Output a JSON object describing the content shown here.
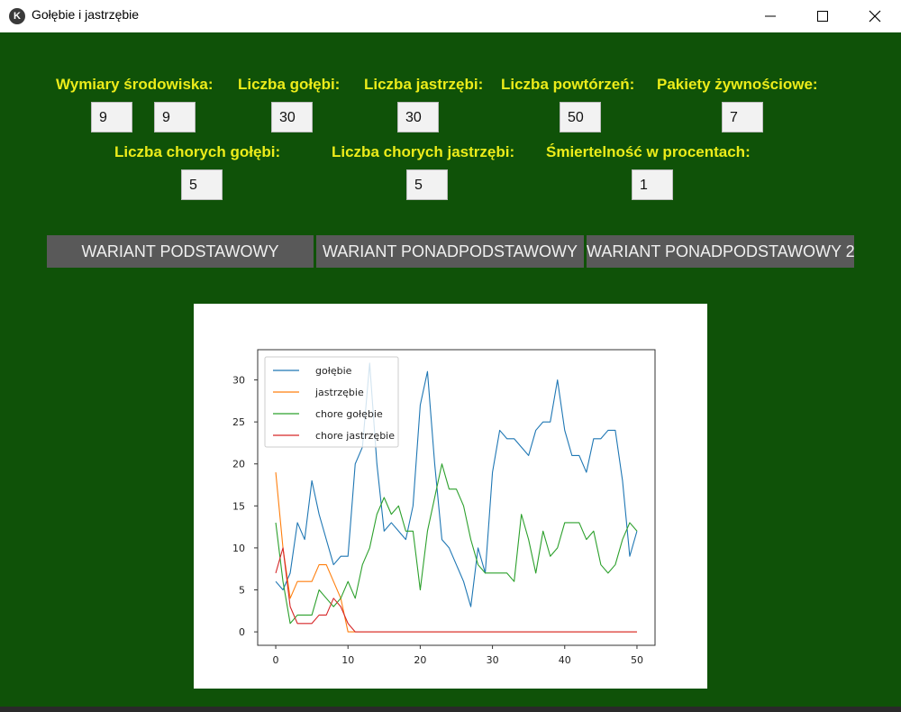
{
  "window": {
    "title": "Gołębie i jastrzębie",
    "app_icon": "kivy-icon"
  },
  "form": {
    "dimensions_label": "Wymiary środowiska:",
    "dimension_x": "9",
    "dimension_y": "9",
    "doves_label": "Liczba gołębi:",
    "doves_value": "30",
    "hawks_label": "Liczba jastrzębi:",
    "hawks_value": "30",
    "repetitions_label": "Liczba powtórzeń:",
    "repetitions_value": "50",
    "food_label": "Pakiety żywnościowe:",
    "food_value": "7",
    "sick_doves_label": "Liczba chorych gołębi:",
    "sick_doves_value": "5",
    "sick_hawks_label": "Liczba chorych jastrzębi:",
    "sick_hawks_value": "5",
    "mortality_label": "Śmiertelność w procentach:",
    "mortality_value": "1"
  },
  "buttons": {
    "basic": "WARIANT PODSTAWOWY",
    "advanced": "WARIANT PONADPODSTAWOWY",
    "advanced2": "WARIANT PONADPODSTAWOWY 2"
  },
  "colors": {
    "background": "#0f5208",
    "label": "#ecec1a",
    "button": "#595959",
    "golebie": "#1f77b4",
    "jastrzebie": "#ff7f0e",
    "chore_golebie": "#2ca02c",
    "chore_jastrzebie": "#d62728"
  },
  "chart_data": {
    "type": "line",
    "title": "",
    "xlabel": "",
    "ylabel": "",
    "xlim": [
      -2.5,
      52.5
    ],
    "ylim": [
      -1.6,
      33.6
    ],
    "xticks": [
      0,
      10,
      20,
      30,
      40,
      50
    ],
    "yticks": [
      0,
      5,
      10,
      15,
      20,
      25,
      30
    ],
    "grid": false,
    "legend_position": "upper-left",
    "x": [
      0,
      1,
      2,
      3,
      4,
      5,
      6,
      7,
      8,
      9,
      10,
      11,
      12,
      13,
      14,
      15,
      16,
      17,
      18,
      19,
      20,
      21,
      22,
      23,
      24,
      25,
      26,
      27,
      28,
      29,
      30,
      31,
      32,
      33,
      34,
      35,
      36,
      37,
      38,
      39,
      40,
      41,
      42,
      43,
      44,
      45,
      46,
      47,
      48,
      49,
      50
    ],
    "series": [
      {
        "name": "gołębie",
        "color": "#1f77b4",
        "values": [
          6,
          5,
          7,
          13,
          11,
          18,
          14,
          11,
          8,
          9,
          9,
          20,
          22,
          32,
          20,
          12,
          13,
          12,
          11,
          15,
          27,
          31,
          20,
          11,
          10,
          8,
          6,
          3,
          10,
          7,
          19,
          24,
          23,
          23,
          22,
          21,
          24,
          25,
          25,
          30,
          24,
          21,
          21,
          19,
          23,
          23,
          24,
          24,
          18,
          9,
          12
        ]
      },
      {
        "name": "jastrzębie",
        "color": "#ff7f0e",
        "values": [
          19,
          10,
          4,
          6,
          6,
          6,
          8,
          8,
          6,
          4,
          0,
          0,
          0,
          0,
          0,
          0,
          0,
          0,
          0,
          0,
          0,
          0,
          0,
          0,
          0,
          0,
          0,
          0,
          0,
          0,
          0,
          0,
          0,
          0,
          0,
          0,
          0,
          0,
          0,
          0,
          0,
          0,
          0,
          0,
          0,
          0,
          0,
          0,
          0,
          0,
          0
        ]
      },
      {
        "name": "chore gołębie",
        "color": "#2ca02c",
        "values": [
          13,
          6,
          1,
          2,
          2,
          2,
          5,
          4,
          3,
          4,
          6,
          4,
          8,
          10,
          14,
          16,
          14,
          15,
          12,
          12,
          5,
          12,
          16,
          20,
          17,
          17,
          15,
          11,
          8,
          7,
          7,
          7,
          7,
          6,
          14,
          11,
          7,
          12,
          9,
          10,
          13,
          13,
          13,
          11,
          12,
          8,
          7,
          8,
          11,
          13,
          12
        ]
      },
      {
        "name": "chore jastrzębie",
        "color": "#d62728",
        "values": [
          7,
          10,
          3,
          1,
          1,
          1,
          2,
          2,
          4,
          3,
          1,
          0,
          0,
          0,
          0,
          0,
          0,
          0,
          0,
          0,
          0,
          0,
          0,
          0,
          0,
          0,
          0,
          0,
          0,
          0,
          0,
          0,
          0,
          0,
          0,
          0,
          0,
          0,
          0,
          0,
          0,
          0,
          0,
          0,
          0,
          0,
          0,
          0,
          0,
          0,
          0
        ]
      }
    ]
  }
}
